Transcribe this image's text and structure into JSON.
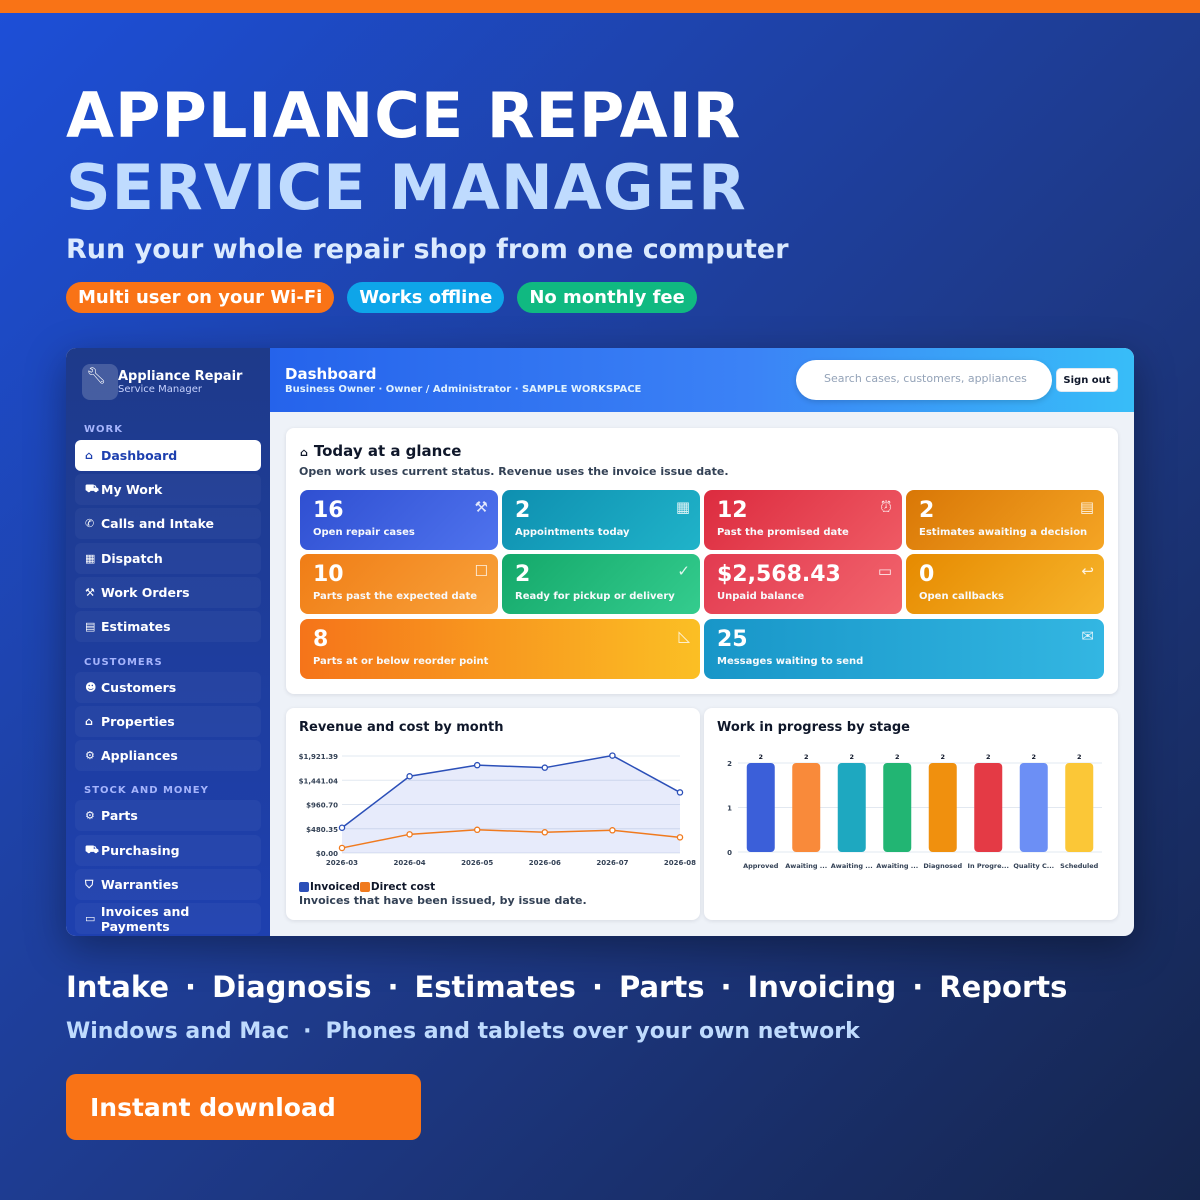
{
  "hero": {
    "title_line1": "APPLIANCE REPAIR",
    "title_line2": "SERVICE MANAGER",
    "subtitle": "Run your whole repair shop from one computer",
    "pills": [
      {
        "label": "Multi user on your Wi-Fi",
        "color": "#f97316"
      },
      {
        "label": "Works offline",
        "color": "#0ea5e9"
      },
      {
        "label": "No monthly fee",
        "color": "#10b981"
      }
    ]
  },
  "app": {
    "brand": {
      "name": "Appliance Repair",
      "sub": "Service Manager",
      "icon": "wrench-icon"
    },
    "sections": {
      "work": "WORK",
      "customers": "CUSTOMERS",
      "stock": "STOCK AND MONEY"
    },
    "nav": [
      {
        "label": "Dashboard",
        "icon": "home-icon",
        "active": true
      },
      {
        "label": "My Work",
        "icon": "car-icon"
      },
      {
        "label": "Calls and Intake",
        "icon": "phone-icon"
      },
      {
        "label": "Dispatch",
        "icon": "calendar-icon"
      },
      {
        "label": "Work Orders",
        "icon": "wrench-icon"
      },
      {
        "label": "Estimates",
        "icon": "document-icon"
      },
      {
        "label": "Customers",
        "icon": "users-icon"
      },
      {
        "label": "Properties",
        "icon": "houses-icon"
      },
      {
        "label": "Appliances",
        "icon": "gear-icon"
      },
      {
        "label": "Parts",
        "icon": "parts-icon"
      },
      {
        "label": "Purchasing",
        "icon": "truck-icon"
      },
      {
        "label": "Warranties",
        "icon": "shield-icon"
      },
      {
        "label": "Invoices and Payments",
        "icon": "card-icon"
      }
    ],
    "header": {
      "title": "Dashboard",
      "subtitle": "Business Owner · Owner / Administrator · SAMPLE WORKSPACE",
      "search_placeholder": "Search cases, customers, appliances",
      "signout": "Sign out"
    },
    "glance": {
      "title": "Today at a glance",
      "note": "Open work uses current status. Revenue uses the invoice issue date.",
      "tiles": [
        {
          "value": "16",
          "label": "Open repair cases",
          "icon": "wrench-icon",
          "color": "#3b5bdb"
        },
        {
          "value": "2",
          "label": "Appointments today",
          "icon": "calendar-icon",
          "color": "#0e9fb8"
        },
        {
          "value": "12",
          "label": "Past the promised date",
          "icon": "alarm-icon",
          "color": "#e03a4a"
        },
        {
          "value": "2",
          "label": "Estimates awaiting a decision",
          "icon": "document-icon",
          "color": "#e08a0a"
        },
        {
          "value": "10",
          "label": "Parts past the expected date",
          "icon": "package-icon",
          "color": "#f28a1c"
        },
        {
          "value": "2",
          "label": "Ready for pickup or delivery",
          "icon": "check-icon",
          "color": "#1eb87a"
        },
        {
          "value": "$2,568.43",
          "label": "Unpaid balance",
          "icon": "card-icon",
          "color": "#e8455a"
        },
        {
          "value": "0",
          "label": "Open callbacks",
          "icon": "return-icon",
          "color": "#e8940a"
        },
        {
          "value": "8",
          "label": "Parts at or below reorder point",
          "icon": "ruler-icon",
          "color": "#f7891d"
        },
        {
          "value": "25",
          "label": "Messages waiting to send",
          "icon": "mail-icon",
          "color": "#1ea5d8"
        }
      ]
    },
    "revenue": {
      "title": "Revenue and cost by month",
      "note": "Invoices that have been issued, by issue date."
    },
    "wip": {
      "title": "Work in progress by stage"
    }
  },
  "chart_data": [
    {
      "type": "line",
      "title": "Revenue and cost by month",
      "x": [
        "2026-03",
        "2026-04",
        "2026-05",
        "2026-06",
        "2026-07",
        "2026-08"
      ],
      "y_ticks": [
        "$0.00",
        "$480.35",
        "$960.70",
        "$1,441.04",
        "$1,921.39"
      ],
      "ylim": [
        0,
        1921.39
      ],
      "series": [
        {
          "name": "Invoiced",
          "color": "#2b4fb8",
          "values": [
            500,
            1520,
            1740,
            1690,
            1930,
            1200
          ]
        },
        {
          "name": "Direct cost",
          "color": "#f07a1e",
          "values": [
            100,
            370,
            460,
            410,
            450,
            310
          ]
        }
      ],
      "grid": true,
      "legend": "bottom-left"
    },
    {
      "type": "bar",
      "title": "Work in progress by stage",
      "categories": [
        "Approved",
        "Awaiting ...",
        "Awaiting ...",
        "Awaiting ...",
        "Diagnosed",
        "In Progre...",
        "Quality C...",
        "Scheduled"
      ],
      "values": [
        2,
        2,
        2,
        2,
        2,
        2,
        2,
        2
      ],
      "colors": [
        "#3b5fd9",
        "#f98a3a",
        "#1ea8c0",
        "#22b573",
        "#f0900e",
        "#e43a45",
        "#6c8ff5",
        "#fbc737"
      ],
      "y_ticks": [
        "0",
        "1",
        "2"
      ],
      "ylim": [
        0,
        2
      ],
      "grid": true
    }
  ],
  "footer": {
    "features": [
      "Intake",
      "Diagnosis",
      "Estimates",
      "Parts",
      "Invoicing",
      "Reports"
    ],
    "platforms": [
      "Windows and Mac",
      "Phones and tablets over your own network"
    ],
    "separator": "·",
    "cta": "Instant download"
  }
}
